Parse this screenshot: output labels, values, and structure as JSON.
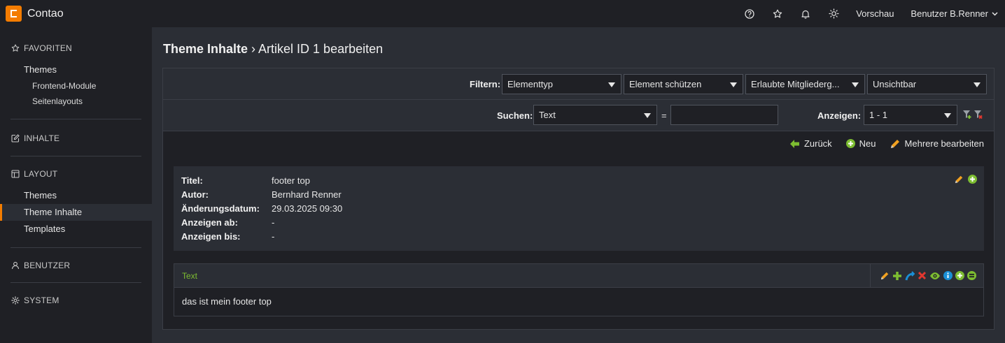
{
  "app": {
    "name": "Contao"
  },
  "topbar": {
    "preview_label": "Vorschau",
    "user_label": "Benutzer B.Renner"
  },
  "sidebar": {
    "favorites": {
      "title": "FAVORITEN",
      "items": [
        "Themes"
      ],
      "subitems": [
        "Frontend-Module",
        "Seitenlayouts"
      ]
    },
    "content": {
      "title": "INHALTE"
    },
    "layout": {
      "title": "LAYOUT",
      "items": [
        "Themes",
        "Theme Inhalte",
        "Templates"
      ]
    },
    "users": {
      "title": "BENUTZER"
    },
    "system": {
      "title": "SYSTEM"
    }
  },
  "main": {
    "title_bold": "Theme Inhalte",
    "title_rest": " › Artikel ID 1 bearbeiten",
    "filter": {
      "label": "Filtern:",
      "selects": [
        "Elementtyp",
        "Element schützen",
        "Erlaubte Mitgliederg...",
        "Unsichtbar"
      ]
    },
    "search": {
      "label": "Suchen:",
      "field": "Text",
      "equals": "=",
      "value": ""
    },
    "show": {
      "label": "Anzeigen:",
      "value": "1 - 1"
    },
    "actions": {
      "back": "Zurück",
      "new": "Neu",
      "edit_multiple": "Mehrere bearbeiten"
    },
    "info": {
      "rows": [
        {
          "k": "Titel:",
          "v": "footer top"
        },
        {
          "k": "Autor:",
          "v": "Bernhard Renner"
        },
        {
          "k": "Änderungsdatum:",
          "v": "29.03.2025 09:30"
        },
        {
          "k": "Anzeigen ab:",
          "v": "-"
        },
        {
          "k": "Anzeigen bis:",
          "v": "-"
        }
      ]
    },
    "element": {
      "type": "Text",
      "content": "das ist mein footer top"
    }
  },
  "colors": {
    "accent": "#f47c00",
    "green": "#7dbd31",
    "red": "#e2372f",
    "blue": "#1a8fd6"
  }
}
